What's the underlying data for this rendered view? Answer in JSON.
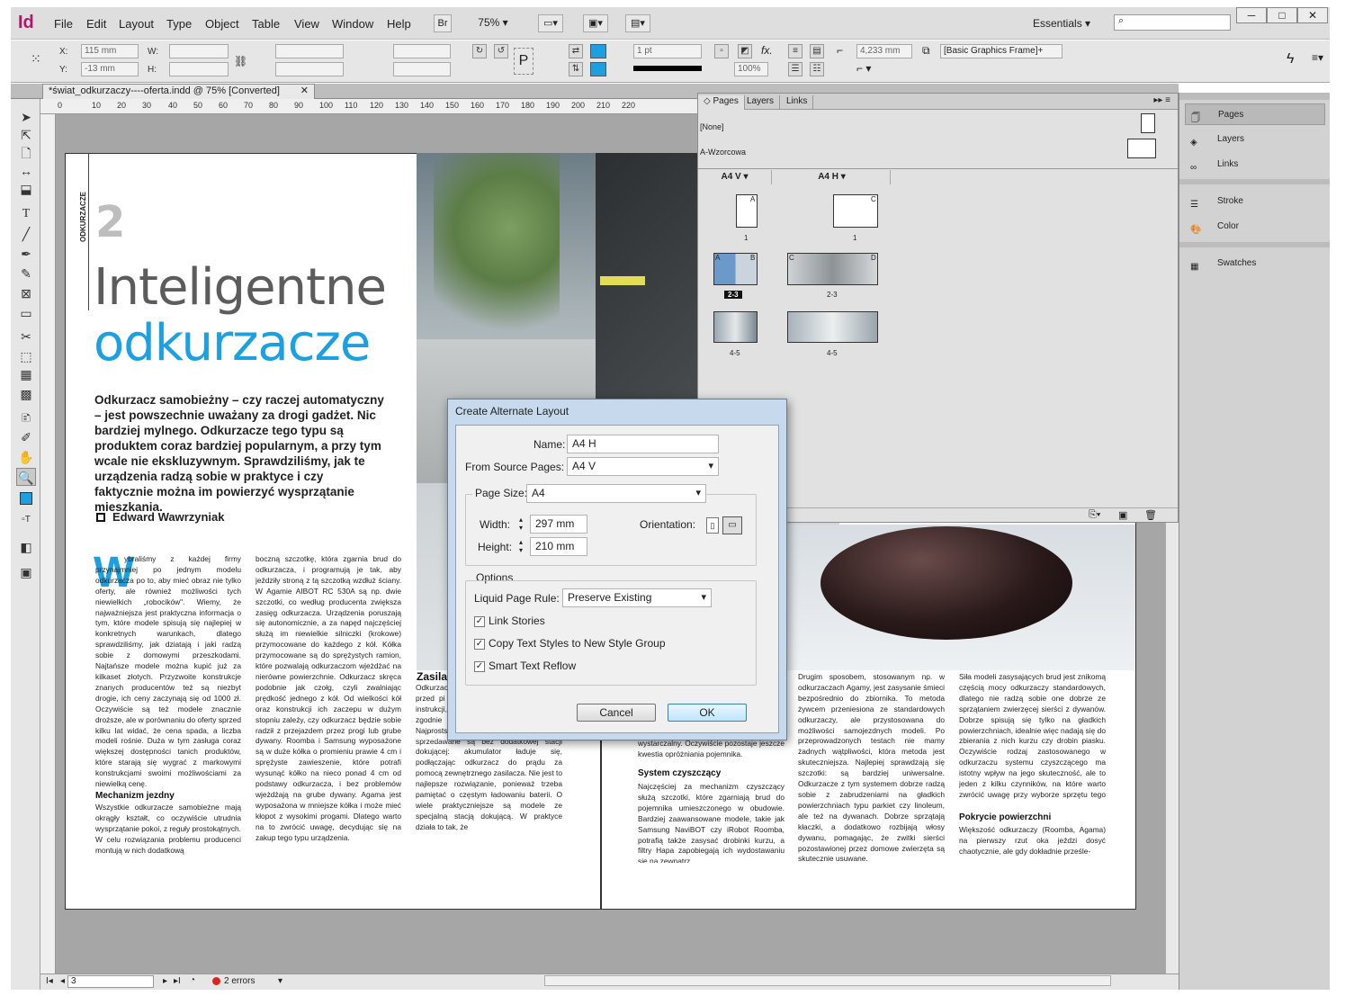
{
  "app": {
    "logo": "Id",
    "workspace": "Essentials",
    "zoom": "75%",
    "bridge": "Br",
    "window_buttons": [
      "─",
      "□",
      "✕"
    ]
  },
  "menu": [
    "File",
    "Edit",
    "Layout",
    "Type",
    "Object",
    "Table",
    "View",
    "Window",
    "Help"
  ],
  "control": {
    "x_label": "X:",
    "x_value": "115 mm",
    "y_label": "Y:",
    "y_value": "-13 mm",
    "w_label": "W:",
    "h_label": "H:",
    "stroke": "1 pt",
    "opacity": "100%",
    "width_val": "4,233 mm",
    "frame_style": "[Basic Graphics Frame]+"
  },
  "doc_tab": {
    "title": "*świat_odkurzaczy----oferta.indd @ 75% [Converted]",
    "close": "✕"
  },
  "ruler": {
    "ticks": [
      "0",
      "10",
      "20",
      "30",
      "40",
      "50",
      "60",
      "70",
      "80",
      "90",
      "100",
      "110",
      "120",
      "130",
      "140",
      "150",
      "160",
      "170",
      "180",
      "190",
      "200",
      "210",
      "220"
    ]
  },
  "article": {
    "section": "ODKURZACZE",
    "number": "2",
    "title1": "Inteligentne",
    "title2": "odkurzacze",
    "lead": "Odkurzacz samobieżny – czy raczej automatyczny – jest powszechnie uważany za drogi gadżet. Nic bardziej mylnego. Odkurzacze tego typu są produktem coraz bardziej popularnym, a przy tym wcale nie ekskluzywnym. Sprawdziliśmy, jak te urządzenia radzą sobie w praktyce i czy faktycznie można im powierzyć wysprzątanie mieszkania.",
    "author": "Edward Wawrzyniak",
    "dropcap": "W",
    "col1": "ybraliśmy z każdej firmy przynajmniej po jednym modelu odkurzacza po to, aby mieć obraz nie tylko oferty, ale również możliwości tych niewielkich „robocików\". Wiemy, że najważniejsza jest praktyczna informacja o tym, które modele spisują się najlepiej w konkretnych warunkach, dlatego sprawdziliśmy, jak dziatają i jaki radzą sobie z domowymi przeszkodami. Najtańsze modele można kupić już za kilkaset złotych. Przyzwoite konstrukcje znanych producentów też są niezbyt drogie, ich ceny zaczynają się od 1000 zł. Oczywiście są też modele znacznie droższe, ale w porównaniu do oferty sprzed kilku lat widać, że cena spada, a liczba modeli rośnie. Duża w tym zasługa coraz większej dostępności tanich produktów, które starają się wygrać z markowymi konstrukcjami swoimi możliwościami za niewielką cenę.",
    "sub1": "Mechanizm jezdny",
    "col1b": "Wszystkie odkurzacze samobieżne mają okrągły kształt, co oczywiście utrudnia wysprzątanie pokoi, z reguły prostokątnych. W celu rozwiązania problemu producenci montują w nich dodatkową",
    "col2": "boczną szczotkę, która zgarnia brud do odkurzacza, i programują je tak, aby jeździły stroną z tą szczotką wzdłuż ściany. W Agamie AIBOT RC 530A są np. dwie szczotki, co według producenta zwiększa zasięg odkurzacza. Urządzenia poruszają się autonomicznie, a za napęd najczęściej służą im niewielkie silniczki (krokowe) przymocowane do każdego z kół. Kółka przymocowane są do sprężystych ramion, które pozwalają odkurzaczom wjeżdżać na nierówne powierzchnie. Odkurzacz skręca podobnie jak czołg, czyli zwalniając prędkość jednego z kół. Od wielkości kół oraz konstrukcji ich zaczepu w dużym stopniu zależy, czy odkurzacz będzie sobie radził z przejazdem przez progi lub grube dywany. Roomba i Samsung wyposażone są w duże kółka o promieniu prawie 4 cm i sprężyste zawieszenie, które potrafi wysunąć kółko na nieco ponad 4 cm od podstawy odkurzacza, i bez problemów wjeżdżają na grube dywany. Agama jest wyposażona w mniejsze kółka i może mieć kłopot z wysokimi progami. Dlatego warto na to zwrócić uwagę, decydując się na zakup tego typu urządzenia.",
    "sub2": "Zasila",
    "col3": "Odkurzacz walnych a dołączam należy r przed pi powania z bateriami opisano w instrukcji, oczywiście radzimy postąpić zgodnie z zaleceniami producenta. Najprostsze odkurzacze, np. Vileda, sprzedawane są bez dodatkowej stacji dokującej: akumulator ładuje się, podłączając odkurzacz do prądu za pomocą zewnętrznego zasilacza. Nie jest to najlepsze rozwiązanie, ponieważ trzeba pamiętać o częstym ładowaniu baterii. O wiele praktyczniejsze są modele ze specjalną stacją dokującą. W praktyce działa to tak, że",
    "col4a": "wystarczalny. Oczywiście pozostaje jeszcze kwestia opróżniania pojemnika.",
    "sub3": "System czyszczący",
    "col4": "Najczęściej za mechanizm czyszczący służą szczotki, które zgarniają brud do pojemnika umieszczonego w obudowie. Bardziej zaawansowane modele, takie jak Samsung NaviBOT czy iRobot Roomba, potrafią także zasysać drobinki kurzu, a filtry Hapa zapobiegają ich wydostawaniu się na zewnątrz.",
    "col5": "Drugim sposobem, stosowanym np. w odkurzaczach Agamy, jest zasysanie śmieci bezpośrednio do zbiornika. To metoda żywcem przeniesiona ze standardowych odkurzaczy, ale przystosowana do możliwości samojezdnych modeli. Po przeprowadzonych testach nie mamy żadnych wątpliwości, która metoda jest skuteczniejsza. Najlepiej sprawdzają się szczotki: są bardziej uniwersalne. Odkurzacze z tym systemem dobrze radzą sobie z zabrudzeniami na gładkich powierzchniach typu parkiet czy linoleum, ale też na dywanach. Dobrze sprzątają kłaczki, a dodatkowo rozbijają włosy dywanu, pomagając, że zwitki sierści pozostawionej przez domowe zwierzęta są skutecznie usuwane.",
    "col6": "Siła modeli zasysających brud jest znikomą częścią mocy odkurzaczy standardowych, dlatego nie radzą sobie one dobrze ze sprzątaniem zwierzęcej sierści z dywanów. Dobrze spisują się tylko na gładkich powierzchniach, idealnie więc nadają się do zbierania z nich kurzu czy drobin piasku. Oczywiście rodzaj zastosowanego w odkurzaczu systemu czyszczącego ma istotny wpływ na jego skuteczność, ale to jeden z kilku czynników, na które warto zwrócić uwagę przy wyborze sprzętu tego typu.",
    "sub4": "Pokrycie powierzchni",
    "col6b": "Większość odkurzaczy (Roomba, Agama) na pierwszy rzut oka jeździ dosyć chaotycznie, ale gdy dokładnie prześle-"
  },
  "pages_panel": {
    "tabs": [
      "Pages",
      "Layers",
      "Links"
    ],
    "masters": [
      "[None]",
      "A-Wzorcowa"
    ],
    "layouts": [
      "A4 V",
      "A4 H"
    ],
    "labels": [
      "1",
      "1",
      "2-3",
      "2-3",
      "4-5",
      "4-5"
    ],
    "letters": [
      "A",
      "C",
      "A",
      "B",
      "C",
      "D"
    ]
  },
  "dock": {
    "items": [
      "Pages",
      "Layers",
      "Links",
      "Stroke",
      "Color",
      "Swatches"
    ]
  },
  "dialog": {
    "title": "Create Alternate Layout",
    "name_label": "Name:",
    "name_value": "A4 H",
    "source_label": "From Source Pages:",
    "source_value": "A4 V",
    "size_label": "Page Size:",
    "size_value": "A4",
    "width_label": "Width:",
    "width_value": "297 mm",
    "height_label": "Height:",
    "height_value": "210 mm",
    "orientation_label": "Orientation:",
    "options_label": "Options",
    "rule_label": "Liquid Page Rule:",
    "rule_value": "Preserve Existing",
    "link_stories": "Link Stories",
    "copy_styles": "Copy Text Styles to New Style Group",
    "smart_reflow": "Smart Text Reflow",
    "cancel": "Cancel",
    "ok": "OK"
  },
  "status": {
    "page": "3",
    "errors": "2 errors"
  }
}
